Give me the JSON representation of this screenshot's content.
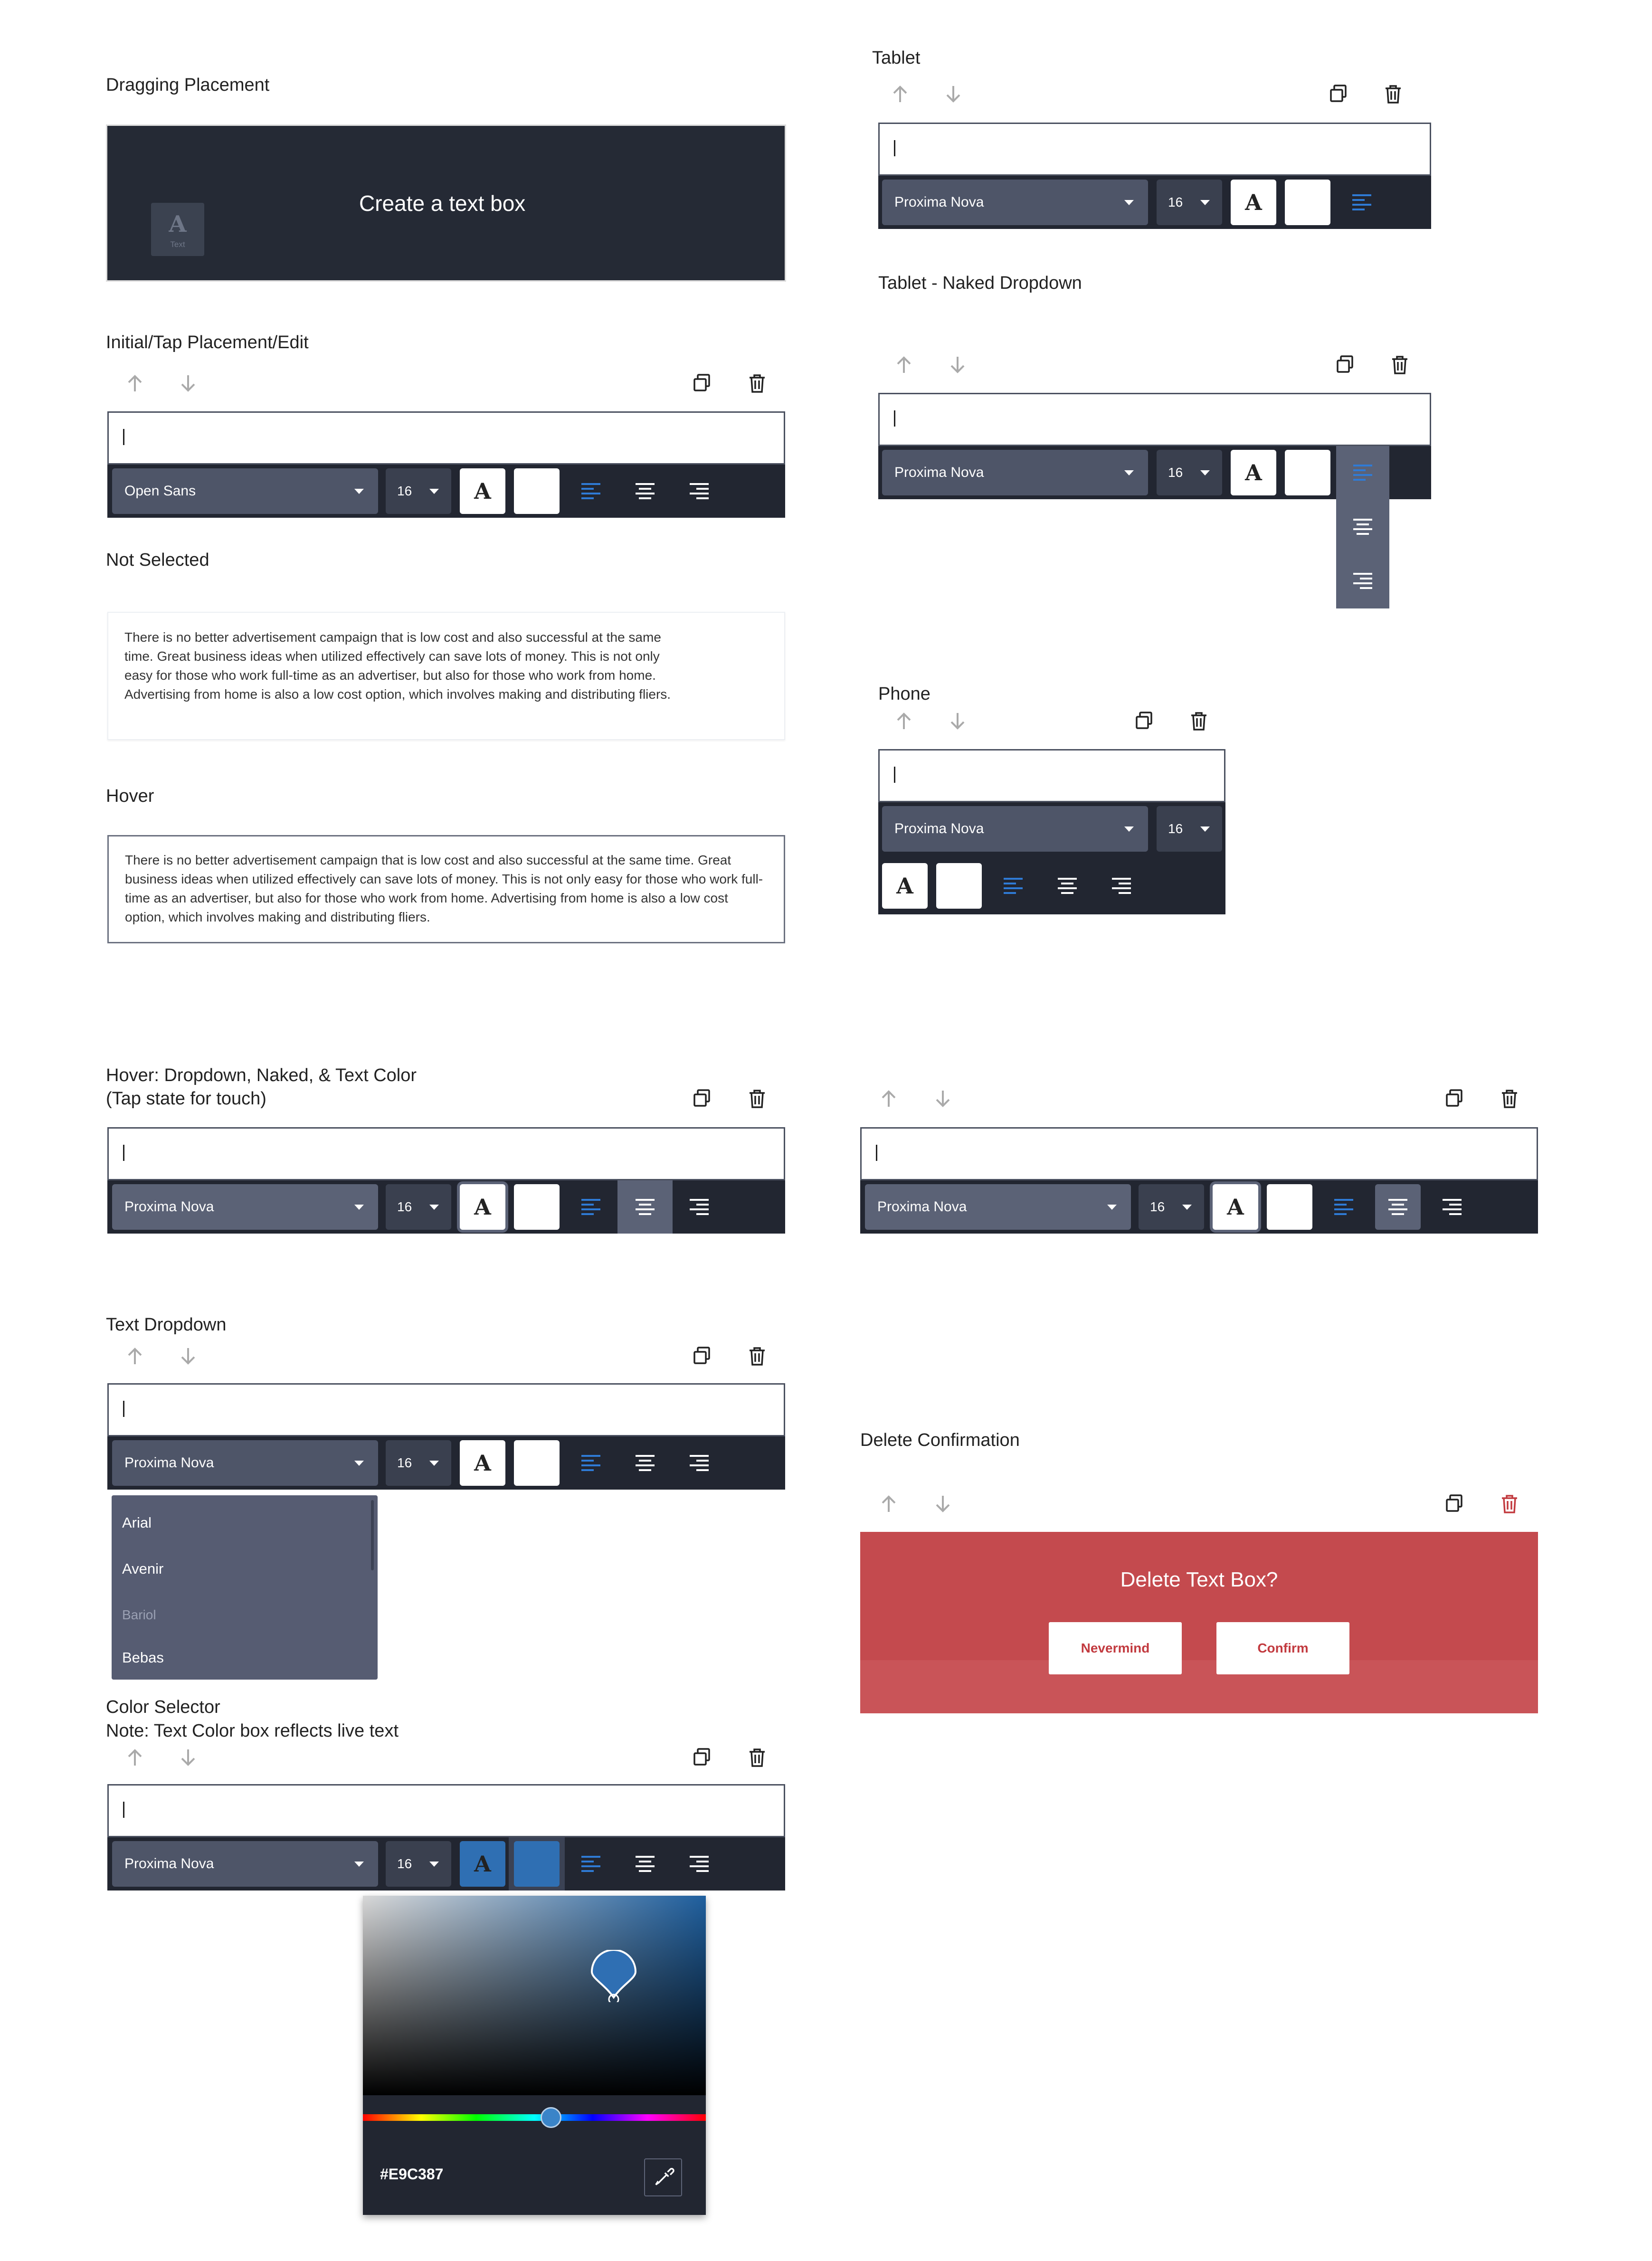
{
  "sections": {
    "dragging": "Dragging Placement",
    "initial": "Initial/Tap Placement/Edit",
    "not_selected": "Not Selected",
    "hover": "Hover",
    "hover_dropdown_line1": "Hover: Dropdown, Naked, & Text Color",
    "hover_dropdown_line2": "(Tap state for touch)",
    "text_dropdown": "Text Dropdown",
    "color_selector_line1": "Color Selector",
    "color_selector_line2": "Note: Text Color box reflects live text",
    "tablet": "Tablet",
    "tablet_naked": "Tablet - Naked Dropdown",
    "phone": "Phone",
    "delete_confirmation": "Delete Confirmation"
  },
  "drag": {
    "message": "Create a text box",
    "tile_glyph": "A",
    "tile_caption": "Text"
  },
  "editor": {
    "caret": "I",
    "text_color_glyph": "A",
    "font_initial": "Open Sans",
    "font": "Proxima Nova",
    "size": "16"
  },
  "paragraph_not_selected": "There is no better advertisement campaign that is low cost and also successful at the same time. Great business ideas when utilized effectively can save lots of money. This is not only easy for those who work full-time as an advertiser, but also for those who work from home. Advertising from home is also a low cost option, which involves making and distributing fliers.",
  "paragraph_hover": "There is no better advertisement campaign that is low cost and also successful at the same time. Great business ideas when utilized effectively can save lots of money. This is not only easy for those who work full-time as an advertiser, but also for those who work from home. Advertising from home is also a low cost option, which involves making and distributing fliers.",
  "font_options": [
    "Arial",
    "Avenir",
    "Bariol",
    "Bebas"
  ],
  "color_picker": {
    "hex": "#E9C387",
    "swatch_color": "#2f6fb3"
  },
  "delete_dialog": {
    "title": "Delete Text Box?",
    "cancel": "Nevermind",
    "confirm": "Confirm"
  },
  "colors": {
    "toolbar_bg": "#222631",
    "select_bg": "#4e5568",
    "accent_blue": "#2f6fb3",
    "danger_red": "#c44a4e"
  },
  "icons": [
    "arrow-up-icon",
    "arrow-down-icon",
    "duplicate-icon",
    "trash-icon",
    "align-left-icon",
    "align-center-icon",
    "align-right-icon",
    "eyedropper-icon"
  ]
}
